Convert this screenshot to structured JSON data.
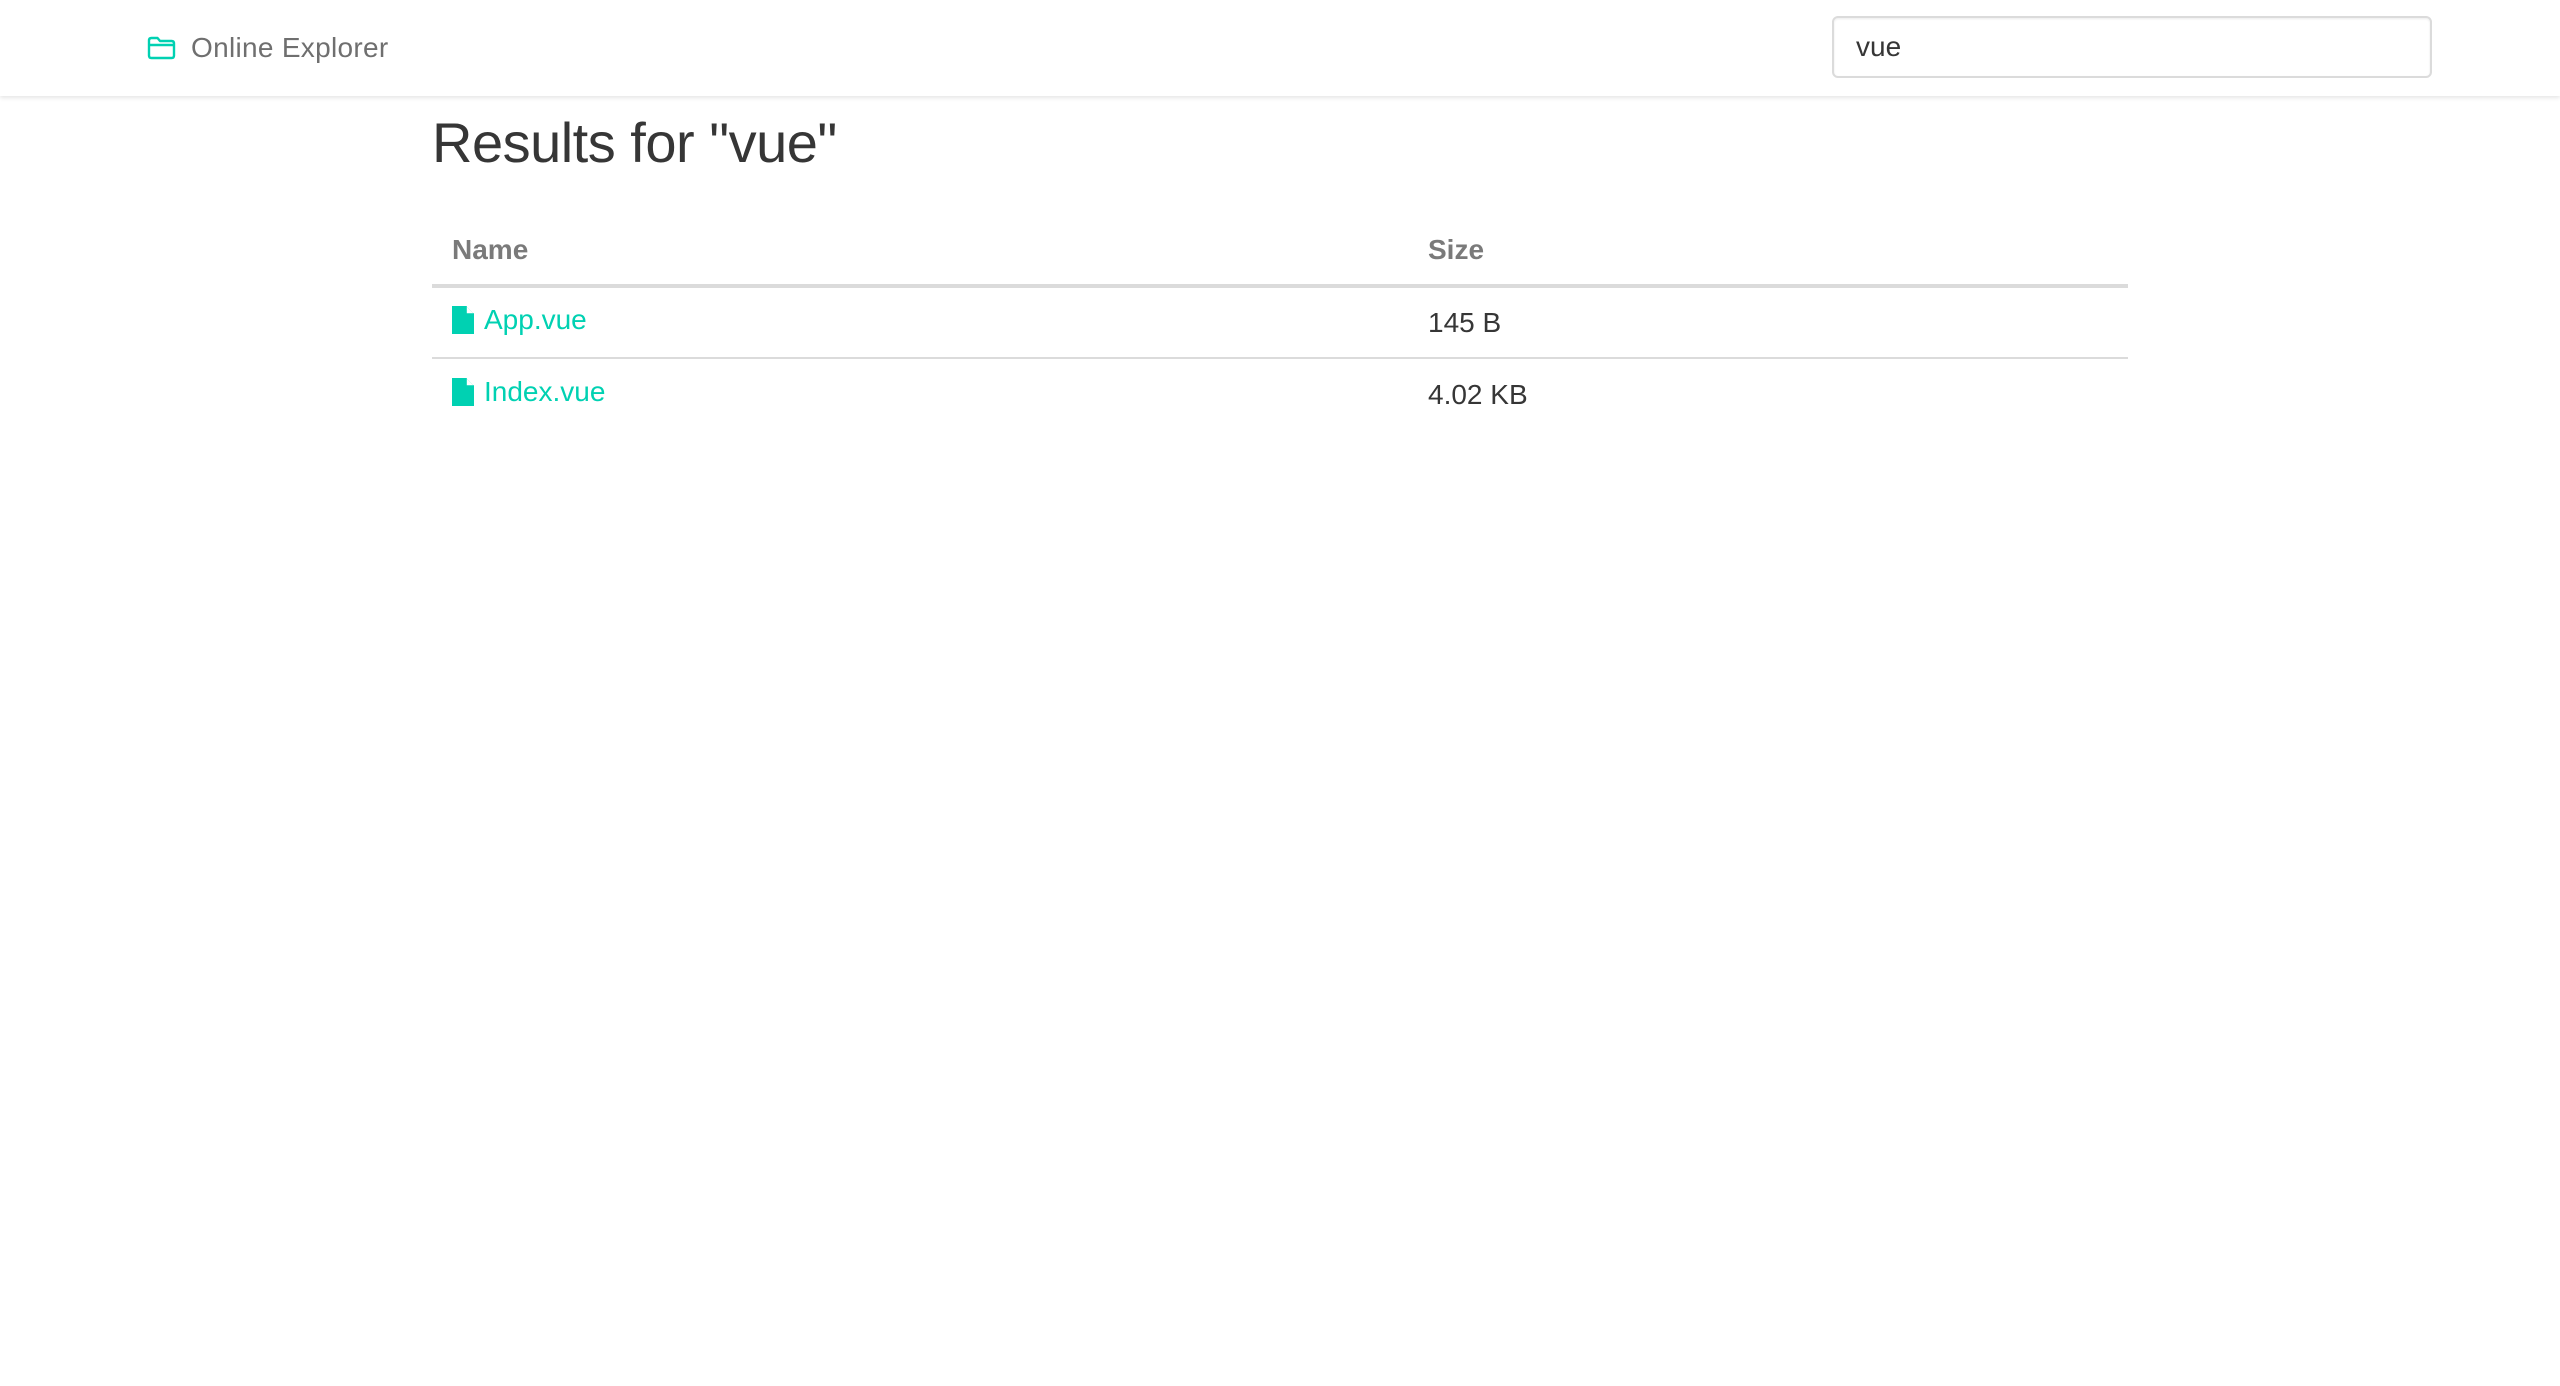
{
  "navbar": {
    "brand_icon": "folder-open-icon",
    "brand_text": "Online Explorer",
    "accent_color": "#00d1b2"
  },
  "search": {
    "value": "vue",
    "placeholder": ""
  },
  "main": {
    "title": "Results for \"vue\"",
    "table": {
      "headers": [
        "Name",
        "Size"
      ],
      "rows": [
        {
          "icon": "file-icon",
          "name": "App.vue",
          "size": "145 B"
        },
        {
          "icon": "file-icon",
          "name": "Index.vue",
          "size": "4.02 KB"
        }
      ]
    }
  }
}
